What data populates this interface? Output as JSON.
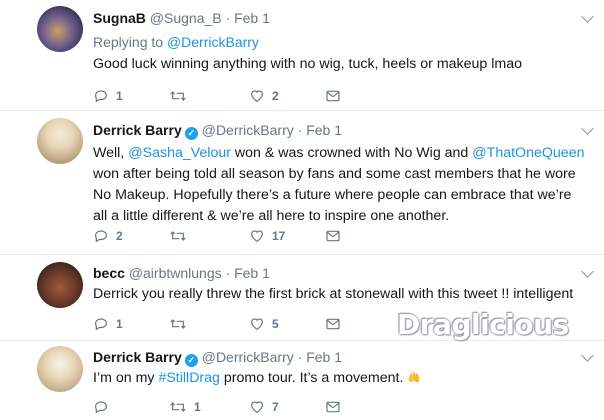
{
  "tweets": [
    {
      "name": "SugnaB",
      "handle": "@Sugna_B",
      "sep": "·",
      "date": "Feb 1",
      "verified": false,
      "replying_prefix": "Replying to ",
      "replying_to": "@DerrickBarry",
      "text": "Good luck winning anything with no wig, tuck, heels or makeup lmao",
      "replies": "1",
      "retweets": "",
      "likes": "2"
    },
    {
      "name": "Derrick Barry",
      "handle": "@DerrickBarry",
      "sep": "·",
      "date": "Feb 1",
      "verified": true,
      "text_parts": {
        "a": "Well, ",
        "mention1": "@Sasha_Velour",
        "b": " won & was crowned with No Wig and ",
        "mention2": "@ThatOneQueen",
        "line2": "won after being told all season by fans and some cast members that he wore",
        "line3": "No Makeup. Hopefully there’s a future where people can embrace that we’re",
        "line4": "all a little different & we’re all here to inspire one another."
      },
      "replies": "2",
      "retweets": "",
      "likes": "17"
    },
    {
      "name": "becc",
      "handle": "@airbtwnlungs",
      "sep": "·",
      "date": "Feb 1",
      "verified": false,
      "text": "Derrick you really threw the first brick at stonewall with this tweet !! intelligent",
      "replies": "1",
      "retweets": "",
      "likes": "5"
    },
    {
      "name": "Derrick Barry",
      "handle": "@DerrickBarry",
      "sep": "·",
      "date": "Feb 1",
      "verified": true,
      "text_parts": {
        "a": "I’m on my ",
        "hashtag": "#StillDrag",
        "b": " promo tour. It’s a movement."
      },
      "emoji": "raised-hands",
      "replies": "",
      "retweets": "1",
      "likes": "7"
    }
  ],
  "watermark": "Draglicious",
  "colors": {
    "link": "#1b95e0",
    "secondary": "#657786",
    "verified": "#1da1f2",
    "divider": "#e6ecf0"
  }
}
